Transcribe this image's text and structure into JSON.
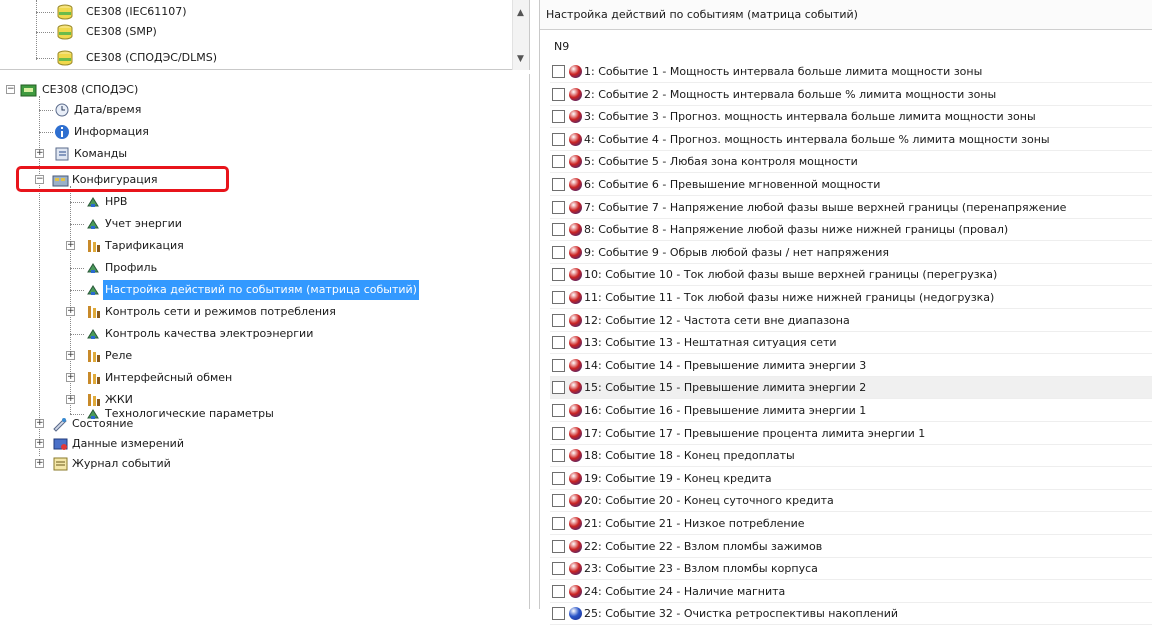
{
  "device_list": {
    "items": [
      "CE308 (IEC61107)",
      "CE308 (SMP)",
      "CE308 (СПОДЭС/DLMS)"
    ],
    "icon": "database-icon"
  },
  "tree": {
    "root": "CE308 (СПОДЭС)",
    "nodes": [
      {
        "label": "Дата/время",
        "icon": "clock-icon"
      },
      {
        "label": "Информация",
        "icon": "info-icon"
      },
      {
        "label": "Команды",
        "icon": "commands-icon"
      },
      {
        "label": "Конфигурация",
        "icon": "config-icon"
      },
      {
        "label": "HPB",
        "icon": "setting-item-icon"
      },
      {
        "label": "Учет энергии",
        "icon": "setting-item-icon"
      },
      {
        "label": "Тарификация",
        "icon": "setting-group-icon"
      },
      {
        "label": "Профиль",
        "icon": "setting-item-icon"
      },
      {
        "label": "Настройка действий по событиям (матрица событий)",
        "icon": "setting-item-icon"
      },
      {
        "label": "Контроль сети и режимов потребления",
        "icon": "setting-group-icon"
      },
      {
        "label": "Контроль качества электроэнергии",
        "icon": "setting-item-icon"
      },
      {
        "label": "Реле",
        "icon": "setting-group-icon"
      },
      {
        "label": "Интерфейсный обмен",
        "icon": "setting-group-icon"
      },
      {
        "label": "ЖКИ",
        "icon": "setting-group-icon"
      },
      {
        "label": "Технологические параметры",
        "icon": "setting-item-icon"
      },
      {
        "label": "Состояние",
        "icon": "state-icon"
      },
      {
        "label": "Данные измерений",
        "icon": "measurements-icon"
      },
      {
        "label": "Журнал событий",
        "icon": "event-log-icon"
      }
    ],
    "highlight_color": "#e8141b",
    "selection_color": "#3399ff"
  },
  "matrix": {
    "title": "Настройка действий по событиям (матрица событий)",
    "column_header": "N9",
    "events": [
      "1: Событие 1 - Мощность интервала больше лимита мощности зоны",
      "2: Событие 2 - Мощность интервала больше % лимита мощности зоны",
      "3: Событие 3 - Прогноз. мощность интервала больше лимита мощности зоны",
      "4: Событие 4 - Прогноз. мощность интервала больше % лимита мощности зоны",
      "5: Событие 5 - Любая зона контроля мощности",
      "6: Событие 6 - Превышение мгновенной мощности",
      "7: Событие 7 - Напряжение любой фазы выше верхней границы (перенапряжение",
      "8: Событие 8 - Напряжение любой фазы ниже нижней границы (провал)",
      "9: Событие 9 - Обрыв любой фазы / нет напряжения",
      "10: Событие 10 - Ток любой фазы выше верхней границы (перегрузка)",
      "11: Событие 11 - Ток любой фазы ниже нижней границы (недогрузка)",
      "12: Событие 12 - Частота сети вне диапазона",
      "13: Событие 13 - Нештатная ситуация сети",
      "14: Событие 14 - Превышение лимита энергии 3",
      "15: Событие 15 - Превышение лимита энергии 2",
      "16: Событие 16 - Превышение лимита энергии 1",
      "17: Событие 17 - Превышение процента лимита энергии 1",
      "18: Событие 18 - Конец предоплаты",
      "19: Событие 19 - Конец кредита",
      "20: Событие 20 - Конец суточного кредита",
      "21: Событие 21 - Низкое потребление",
      "22: Событие 22 - Взлом пломбы зажимов",
      "23: Событие 23 - Взлом пломбы корпуса",
      "24: Событие 24 - Наличие магнита",
      "25: Событие 32 - Очистка ретроспективы накоплений"
    ],
    "ball_color_red": "#cc2222",
    "ball_color_blue": "#2a55c8"
  }
}
